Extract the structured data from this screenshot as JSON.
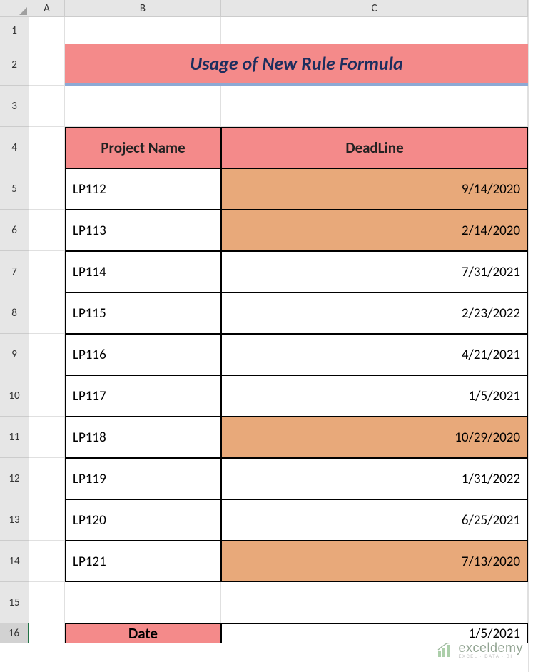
{
  "columns": [
    "A",
    "B",
    "C"
  ],
  "rows": [
    "1",
    "2",
    "3",
    "4",
    "5",
    "6",
    "7",
    "8",
    "9",
    "10",
    "11",
    "12",
    "13",
    "14",
    "15",
    "16"
  ],
  "selected_row": "16",
  "title": "Usage of New Rule Formula",
  "headers": {
    "project": "Project Name",
    "deadline": "DeadLine"
  },
  "data": [
    {
      "project": "LP112",
      "deadline": "9/14/2020",
      "highlight": true
    },
    {
      "project": "LP113",
      "deadline": "2/14/2020",
      "highlight": true
    },
    {
      "project": "LP114",
      "deadline": "7/31/2021",
      "highlight": false
    },
    {
      "project": "LP115",
      "deadline": "2/23/2022",
      "highlight": false
    },
    {
      "project": "LP116",
      "deadline": "4/21/2021",
      "highlight": false
    },
    {
      "project": "LP117",
      "deadline": "1/5/2021",
      "highlight": false
    },
    {
      "project": "LP118",
      "deadline": "10/29/2020",
      "highlight": true
    },
    {
      "project": "LP119",
      "deadline": "1/31/2022",
      "highlight": false
    },
    {
      "project": "LP120",
      "deadline": "6/25/2021",
      "highlight": false
    },
    {
      "project": "LP121",
      "deadline": "7/13/2020",
      "highlight": true
    }
  ],
  "date_label": "Date",
  "date_value": "1/5/2021",
  "watermark": {
    "main": "exceldemy",
    "sub": "EXCEL · DATA · BI"
  },
  "chart_data": {
    "type": "table",
    "title": "Usage of New Rule Formula",
    "columns": [
      "Project Name",
      "DeadLine"
    ],
    "rows": [
      [
        "LP112",
        "9/14/2020"
      ],
      [
        "LP113",
        "2/14/2020"
      ],
      [
        "LP114",
        "7/31/2021"
      ],
      [
        "LP115",
        "2/23/2022"
      ],
      [
        "LP116",
        "4/21/2021"
      ],
      [
        "LP117",
        "1/5/2021"
      ],
      [
        "LP118",
        "10/29/2020"
      ],
      [
        "LP119",
        "1/31/2022"
      ],
      [
        "LP120",
        "6/25/2021"
      ],
      [
        "LP121",
        "7/13/2020"
      ]
    ],
    "reference_date": "1/5/2021",
    "highlighted_rows": [
      0,
      1,
      6,
      9
    ]
  }
}
